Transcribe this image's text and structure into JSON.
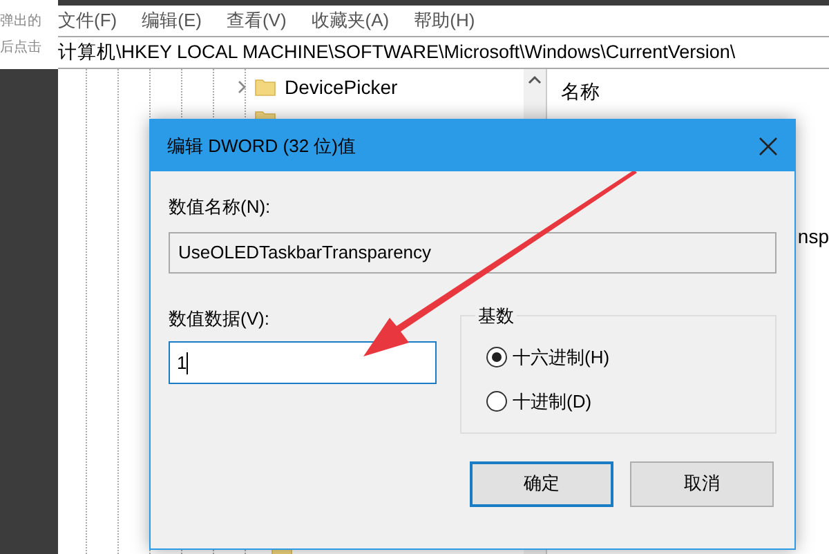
{
  "background_page": {
    "lines": [
      "弹出的",
      "后点击"
    ]
  },
  "menu": [
    "文件(F)",
    "编辑(E)",
    "查看(V)",
    "收藏夹(A)",
    "帮助(H)"
  ],
  "address_bar": {
    "path": "计算机\\HKEY LOCAL MACHINE\\SOFTWARE\\Microsoft\\Windows\\CurrentVersion\\"
  },
  "tree": {
    "items": [
      {
        "label": "DevicePicker",
        "expandable": true
      }
    ]
  },
  "list": {
    "column_1": "名称",
    "cell_fragment": "nsp"
  },
  "dialog": {
    "title": "编辑 DWORD (32 位)值",
    "name_label": "数值名称(N):",
    "name_value": "UseOLEDTaskbarTransparency",
    "data_label": "数值数据(V):",
    "data_value": "1",
    "base_group": {
      "title": "基数",
      "options": [
        {
          "label": "十六进制(H)",
          "selected": true
        },
        {
          "label": "十进制(D)",
          "selected": false
        }
      ]
    },
    "buttons": [
      {
        "label": "确定",
        "default": true
      },
      {
        "label": "取消",
        "default": false
      }
    ]
  }
}
